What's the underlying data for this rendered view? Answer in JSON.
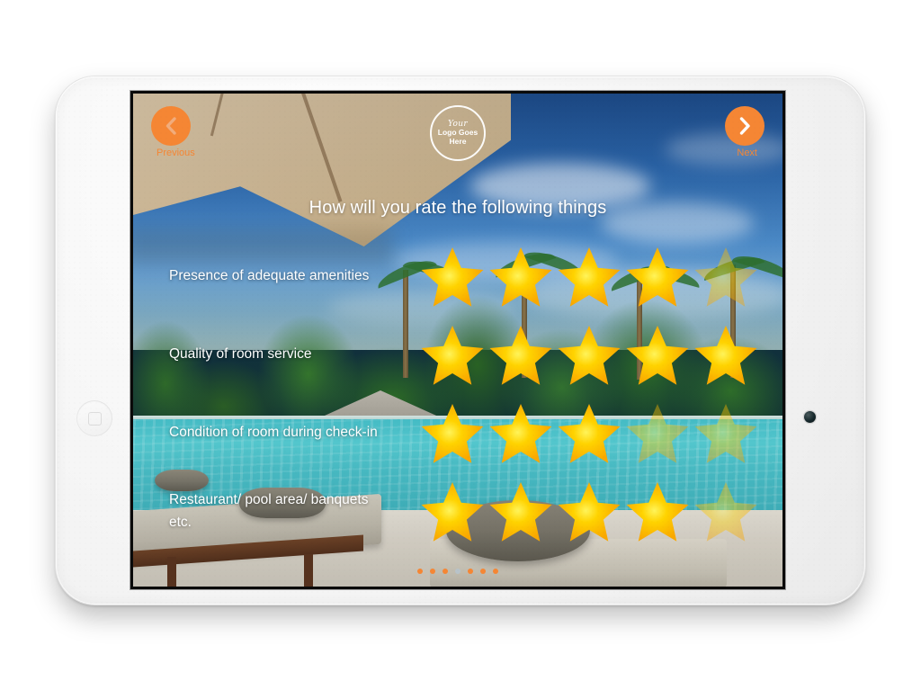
{
  "device": {
    "type": "tablet",
    "bezel_color": "#f2f2f2",
    "home_button_name": "home-button",
    "camera_name": "front-camera"
  },
  "header": {
    "previous": {
      "label": "Previous",
      "icon": "chevron-left-icon"
    },
    "next": {
      "label": "Next",
      "icon": "chevron-right-icon"
    },
    "logo": {
      "line1": "Your",
      "line2": "Logo Goes",
      "line3": "Here"
    }
  },
  "survey": {
    "title": "How will you rate the following things",
    "max_rating": 5,
    "questions": [
      {
        "label": "Presence of adequate amenities",
        "rating": 4
      },
      {
        "label": "Quality of room service",
        "rating": 5
      },
      {
        "label": "Condition of room during check-in",
        "rating": 3
      },
      {
        "label": "Restaurant/ pool area/ banquets etc.",
        "rating": 4
      }
    ]
  },
  "pagination": {
    "total": 7,
    "active_index": 3
  },
  "colors": {
    "accent_orange": "#f58634",
    "star_gold": "#ffd300",
    "star_gold_edge": "#f9a800",
    "dot_active": "#b8c3c9",
    "text_white": "#ffffff"
  }
}
